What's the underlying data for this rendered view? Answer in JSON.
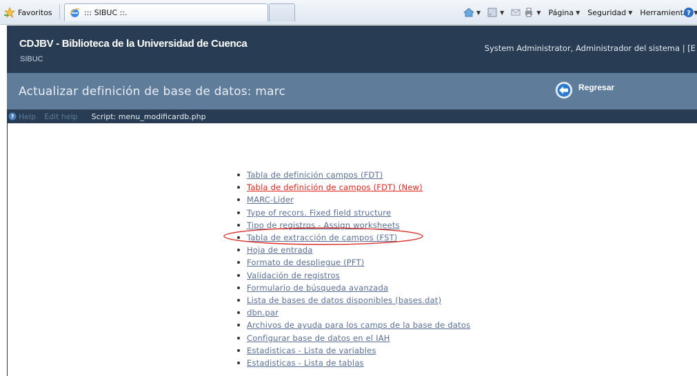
{
  "browser": {
    "favorites_label": "Favoritos",
    "tab_title": "::: SIBUC ::.",
    "commands": {
      "page_label": "Página",
      "security_label": "Seguridad",
      "tools_label": "Herramientas"
    }
  },
  "header": {
    "site_title": "CDJBV - Biblioteca de la Universidad de Cuenca",
    "site_subtitle": "SIBUC",
    "user_info": "System Administrator, Administrador del sistema | [E"
  },
  "section": {
    "title": "Actualizar definición de base de datos: marc",
    "back_label": "Regresar"
  },
  "help_bar": {
    "help_label": "Help",
    "edit_help_label": "Edit help",
    "script_label": "Script: menu_modificardb.php"
  },
  "menu": {
    "items": [
      {
        "label": "Tabla de definición campos (FDT)"
      },
      {
        "label": "Tabla de definición de campos (FDT) (New)"
      },
      {
        "label": "MARC-Lider"
      },
      {
        "label": "Type of recors. Fixed field structure"
      },
      {
        "label": "Tipo de registros - Assign worksheets"
      },
      {
        "label": "Tabla de extracción de campos (FST)"
      },
      {
        "label": "Hoja de entrada"
      },
      {
        "label": "Formato de despliegue (PFT)"
      },
      {
        "label": "Validación de registros"
      },
      {
        "label": "Formulario de búsqueda avanzada"
      },
      {
        "label": "Lista de bases de datos disponibles (bases.dat)"
      },
      {
        "label": "dbn.par"
      },
      {
        "label": "Archivos de ayuda para los camps de la base de datos"
      },
      {
        "label": "Configurar base de datos en el IAH"
      },
      {
        "label": "Estadisticas - Lista de variables"
      },
      {
        "label": "Estadisticas - Lista de tablas"
      }
    ]
  },
  "colors": {
    "header_bg": "#283d54",
    "section_bg": "#5f7d9b",
    "link": "#5a6f95",
    "link_highlight": "#e2231a",
    "annotation_ellipse": "#d9302a"
  }
}
